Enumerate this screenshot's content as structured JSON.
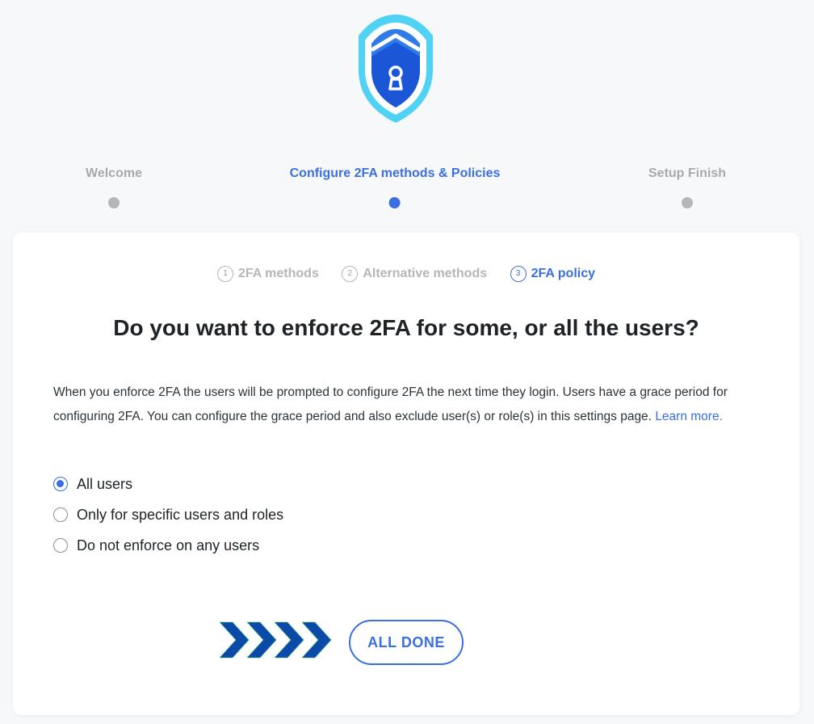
{
  "logo": {
    "icon": "shield-lock-icon",
    "colors": {
      "outer": "#2f7bea",
      "inner": "#1b56d6",
      "accent": "#4fd2f4"
    }
  },
  "wizard_steps": [
    {
      "label": "Welcome",
      "state": "done"
    },
    {
      "label": "Configure 2FA methods & Policies",
      "state": "active"
    },
    {
      "label": "Setup Finish",
      "state": "pending"
    }
  ],
  "subtabs": [
    {
      "num": "1",
      "label": "2FA methods"
    },
    {
      "num": "2",
      "label": "Alternative methods"
    },
    {
      "num": "3",
      "label": "2FA policy"
    }
  ],
  "heading": "Do you want to enforce 2FA for some, or all the users?",
  "description": "When you enforce 2FA the users will be prompted to configure 2FA the next time they login. Users have a grace period for configuring 2FA. You can configure the grace period and also exclude user(s) or role(s) in this settings page.",
  "learn_more": "Learn more.",
  "options": [
    {
      "label": "All users",
      "selected": true
    },
    {
      "label": "Only for specific users and roles",
      "selected": false
    },
    {
      "label": "Do not enforce on any users",
      "selected": false
    }
  ],
  "done_button": "ALL DONE",
  "colors": {
    "accent": "#3b6fe0",
    "muted": "#a7aaad",
    "arrow": "#0b4aa8",
    "arrow_outline": "#37c259"
  }
}
